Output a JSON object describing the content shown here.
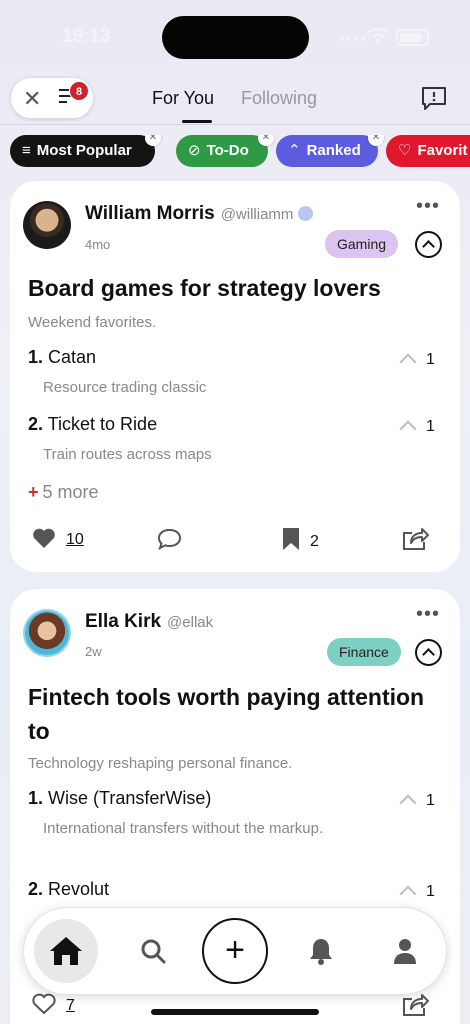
{
  "status": {
    "time": "19:13"
  },
  "header": {
    "filter_badge": "8",
    "tabs": [
      {
        "label": "For You"
      },
      {
        "label": "Following"
      }
    ]
  },
  "chips": [
    {
      "label": "Most Popular",
      "color": "#141414"
    },
    {
      "label": "To-Do",
      "color": "#2e9a46"
    },
    {
      "label": "Ranked",
      "color": "#5b5ce0"
    },
    {
      "label": "Favorit",
      "color": "#e0182e"
    }
  ],
  "posts": [
    {
      "author": "William Morris",
      "handle": "@williamm",
      "age": "4mo",
      "tag": "Gaming",
      "title": "Board games for strategy lovers",
      "subtitle": "Weekend favorites.",
      "items": [
        {
          "num": "1.",
          "name": "Catan",
          "desc": "Resource trading classic",
          "votes": "1"
        },
        {
          "num": "2.",
          "name": "Ticket to Ride",
          "desc": "Train routes across maps",
          "votes": "1"
        }
      ],
      "more": "5 more",
      "likes": "10",
      "saves": "2"
    },
    {
      "author": "Ella Kirk",
      "handle": "@ellak",
      "age": "2w",
      "tag": "Finance",
      "title": "Fintech tools worth paying attention to",
      "subtitle": "Technology reshaping personal finance.",
      "items": [
        {
          "num": "1.",
          "name": "Wise (TransferWise)",
          "desc": "International transfers without the markup.",
          "votes": "1"
        },
        {
          "num": "2.",
          "name": "Revolut",
          "votes": "1"
        }
      ],
      "likes": "7"
    }
  ],
  "nav": {
    "add_label": "+"
  }
}
